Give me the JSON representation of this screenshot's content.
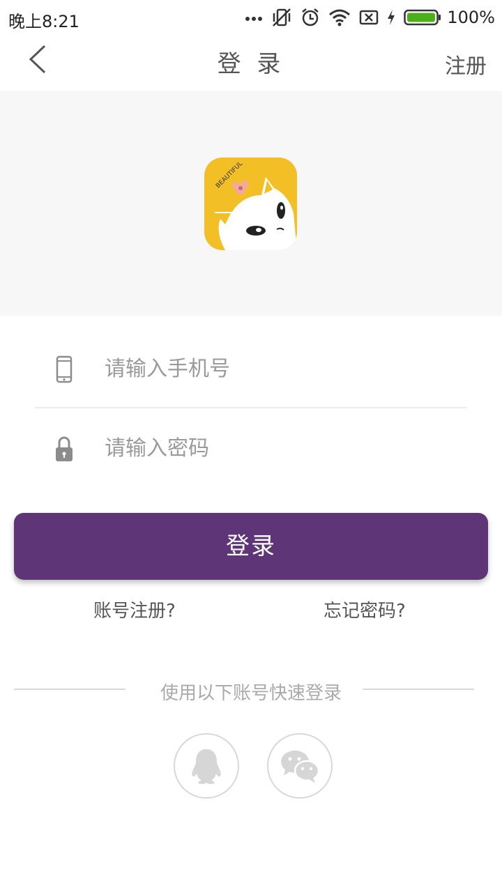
{
  "status_bar": {
    "time": "晚上8:21",
    "battery_percent": "100%",
    "icons": [
      "more-dots-icon",
      "vibrate-off-icon",
      "alarm-icon",
      "wifi-icon",
      "sim-off-icon",
      "charging-icon",
      "battery-icon"
    ]
  },
  "nav": {
    "title": "登 录",
    "register_label": "注册",
    "back_icon": "chevron-left-icon"
  },
  "hero": {
    "logo_text": "BEAUTIFUL",
    "logo_bg": "#f2bf27"
  },
  "form": {
    "phone_placeholder": "请输入手机号",
    "phone_value": "",
    "password_placeholder": "请输入密码",
    "password_value": ""
  },
  "actions": {
    "login_label": "登录",
    "register_link": "账号注册?",
    "forgot_link": "忘记密码?"
  },
  "quick_login": {
    "label": "使用以下账号快速登录",
    "providers": [
      "qq",
      "wechat"
    ]
  },
  "colors": {
    "accent": "#5e3577",
    "hero_bg": "#f7f7f7"
  }
}
